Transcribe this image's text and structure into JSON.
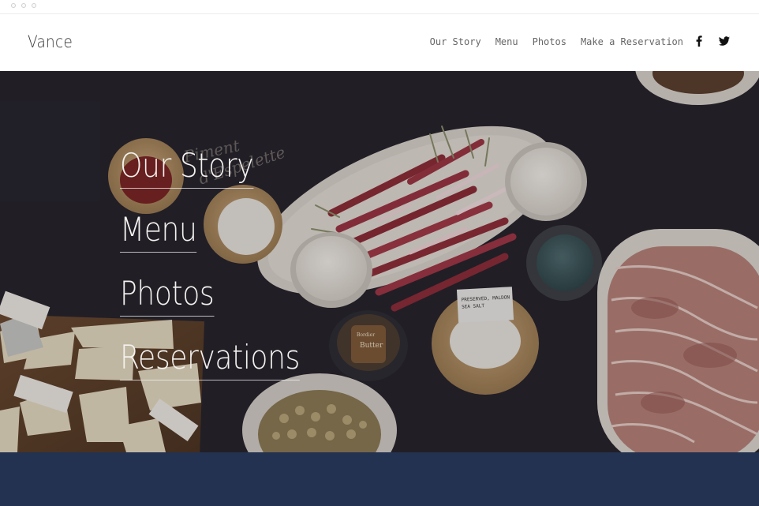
{
  "brand": {
    "name": "Vance"
  },
  "nav": {
    "items": [
      {
        "label": "Our Story"
      },
      {
        "label": "Menu"
      },
      {
        "label": "Photos"
      },
      {
        "label": "Make a Reservation"
      }
    ],
    "social": [
      {
        "icon": "facebook-icon"
      },
      {
        "icon": "twitter-icon"
      }
    ]
  },
  "hero": {
    "links": [
      {
        "label": "Our Story"
      },
      {
        "label": "Menu"
      },
      {
        "label": "Photos"
      },
      {
        "label": "Reservations"
      }
    ],
    "photo_labels": {
      "card_salt": "PRESERVED, MALDON SEA SALT",
      "tub_brand": "Bordier",
      "tub_label": "Butter",
      "handwritten": "Piment d'Espelette"
    }
  },
  "colors": {
    "header_bg": "#ffffff",
    "brand_text": "#3a3a3a",
    "nav_text": "#666666",
    "hero_text": "#f3f1ee",
    "footer_band": "#233250"
  }
}
